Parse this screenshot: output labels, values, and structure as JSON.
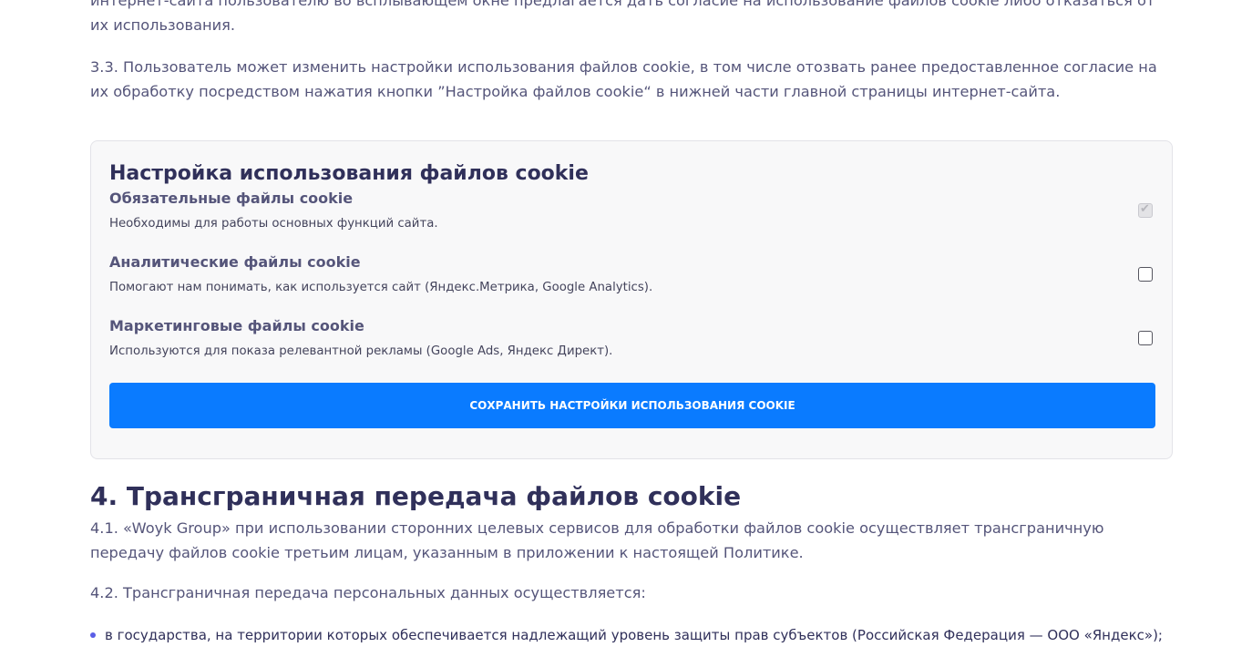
{
  "paragraphs": {
    "top_fragment": "интернет-сайта пользователю во всплывающем окне предлагается дать согласие на использование файлов cookie либо отказаться от их использования.",
    "p33": "3.3. Пользователь может изменить настройки использования файлов cookie, в том числе отозвать ранее предоставленное согласие на их обработку посредством нажатия кнопки ”Настройка файлов cookie“ в нижней части главной страницы интернет-сайта."
  },
  "cookie_settings": {
    "title": "Настройка использования файлов cookie",
    "items": [
      {
        "name": "Обязательные файлы cookie",
        "description": "Необходимы для работы основных функций сайта.",
        "checked": true,
        "disabled": true
      },
      {
        "name": "Аналитические файлы cookie",
        "description": "Помогают нам понимать, как используется сайт (Яндекс.Метрика, Google Analytics).",
        "checked": false,
        "disabled": false
      },
      {
        "name": "Маркетинговые файлы cookie",
        "description": "Используются для показа релевантной рекламы (Google Ads, Яндекс Директ).",
        "checked": false,
        "disabled": false
      }
    ],
    "save_label": "Сохранить настройки использования cookie"
  },
  "section4": {
    "title": "4. Трансграничная передача файлов cookie",
    "p41": "4.1. «Woyk Group» при использовании сторонних целевых сервисов для обработки файлов cookie осуществляет трансграничную передачу файлов cookie третьим лицам, указанным в приложении к настоящей Политике.",
    "p42": "4.2. Трансграничная передача персональных данных осуществляется:",
    "bullets": [
      "в государства, на территории которых обеспечивается надлежащий уровень защиты прав субъектов (Российская Федерация — ООО «Яндекс»);"
    ]
  },
  "colors": {
    "accent": "#0a7bff",
    "heading": "#30305a",
    "body_text": "#55557a",
    "bullet": "#5a5ee6"
  }
}
